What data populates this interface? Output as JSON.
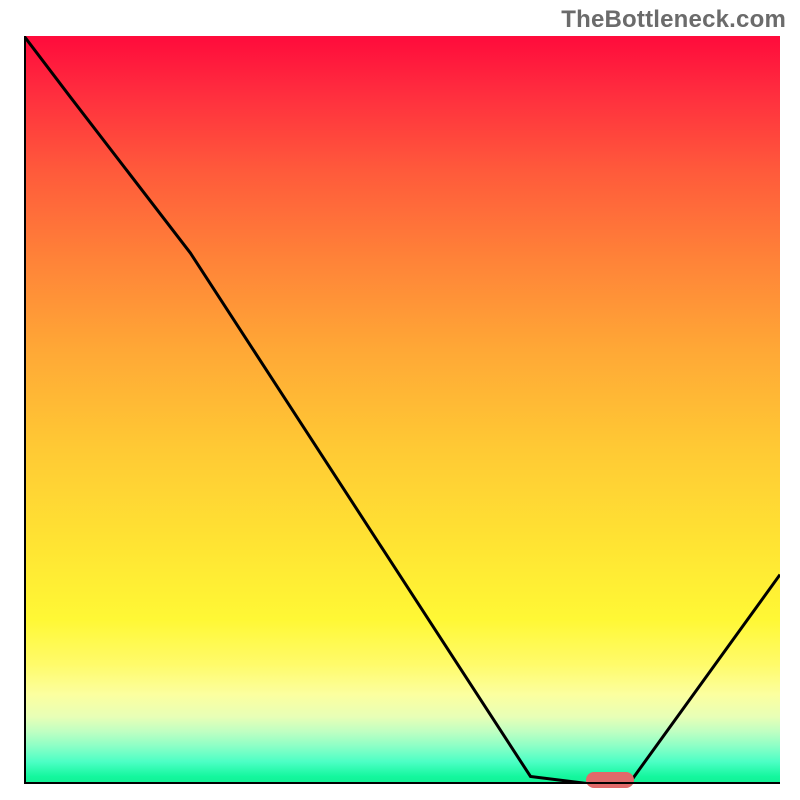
{
  "watermark": "TheBottleneck.com",
  "chart_data": {
    "type": "line",
    "title": "",
    "xlabel": "",
    "ylabel": "",
    "xlim": [
      0,
      100
    ],
    "ylim": [
      0,
      100
    ],
    "x": [
      0,
      6,
      22,
      67,
      75,
      80,
      100
    ],
    "y": [
      100,
      92,
      71,
      1,
      0,
      0,
      28
    ],
    "marker": {
      "x": 77.5,
      "y": 0
    },
    "colors": {
      "gradient_top": "#ff0b3c",
      "gradient_bottom": "#12ef94",
      "curve": "#000000",
      "marker": "#e06a6a",
      "axes": "#000000"
    },
    "grid": false,
    "legend": null
  }
}
